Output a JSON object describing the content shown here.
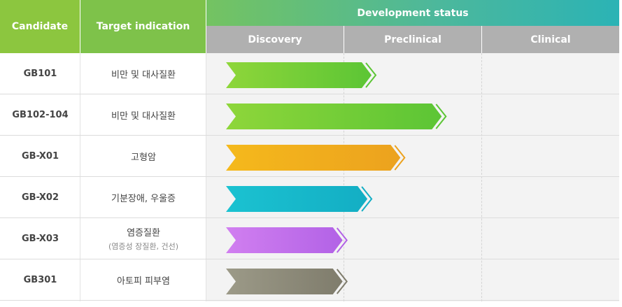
{
  "header": {
    "candidate_label": "Candidate",
    "target_label": "Target indication",
    "development_label": "Development status",
    "stages": [
      "Discovery",
      "Preclinical",
      "Clinical"
    ]
  },
  "rows": [
    {
      "candidate": "GB101",
      "target": "비만 및 대사질환",
      "target_sub": "",
      "progress": 0.4,
      "color_start": "#8ed63a",
      "color_end": "#5cc535"
    },
    {
      "candidate": "GB102-104",
      "target": "비만 및 대사질환",
      "target_sub": "",
      "progress": 0.57,
      "color_start": "#8ed63a",
      "color_end": "#5cc535"
    },
    {
      "candidate": "GB-X01",
      "target": "고형암",
      "target_sub": "",
      "progress": 0.47,
      "color_start": "#f5b91c",
      "color_end": "#eca21e"
    },
    {
      "candidate": "GB-X02",
      "target": "기분장애, 우울증",
      "target_sub": "",
      "progress": 0.39,
      "color_start": "#1bc2d1",
      "color_end": "#13aec4"
    },
    {
      "candidate": "GB-X03",
      "target": "염증질환",
      "target_sub": "(염증성 장질환, 건선)",
      "progress": 0.33,
      "color_start": "#d17ff0",
      "color_end": "#b262e6"
    },
    {
      "candidate": "GB301",
      "target": "아토피 피부염",
      "target_sub": "",
      "progress": 0.33,
      "color_start": "#9c9a88",
      "color_end": "#7f7c6c"
    }
  ]
}
